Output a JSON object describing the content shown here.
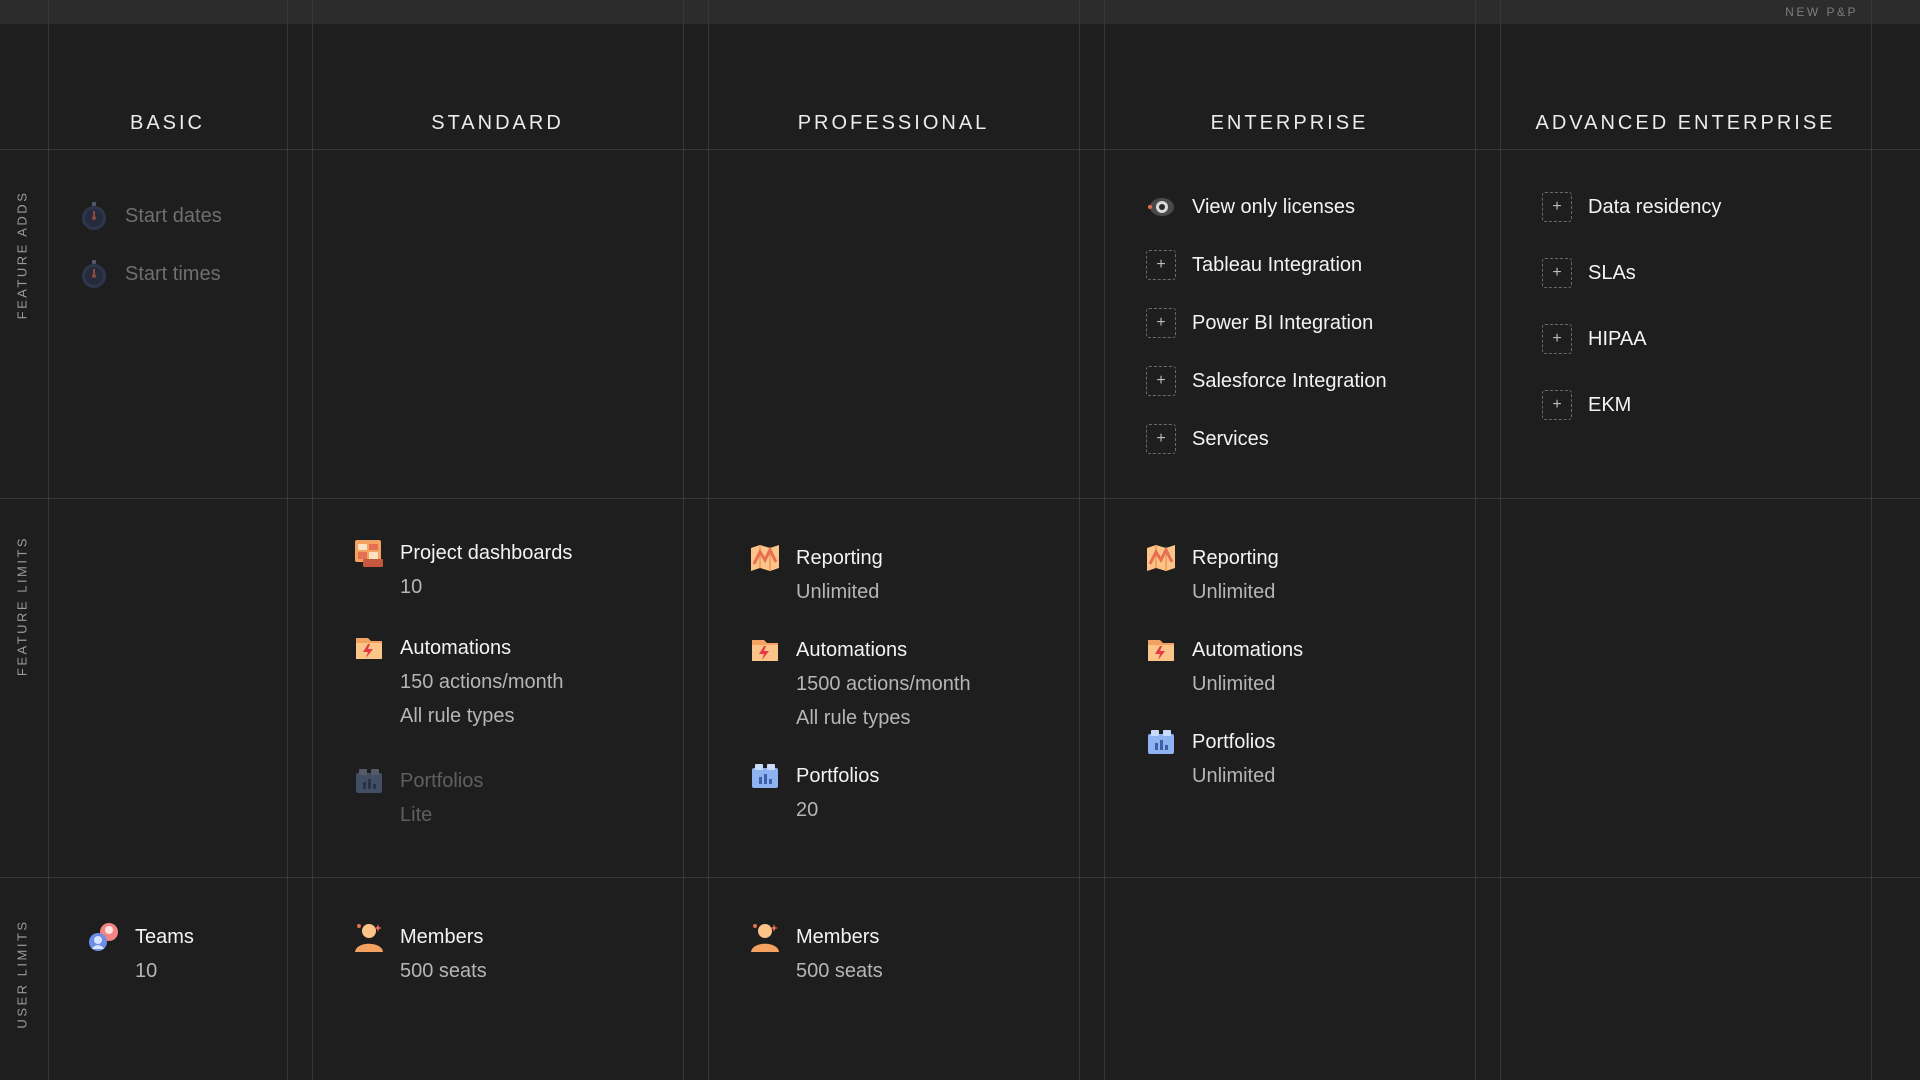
{
  "topbar": {
    "label": "NEW P&P"
  },
  "plans": [
    "BASIC",
    "STANDARD",
    "PROFESSIONAL",
    "ENTERPRISE",
    "ADVANCED ENTERPRISE"
  ],
  "row_labels": {
    "feature_adds": "FEATURE ADDS",
    "feature_limits": "FEATURE LIMITS",
    "user_limits": "USER LIMITS"
  },
  "feature_adds": {
    "basic": [
      {
        "icon": "stopwatch-icon",
        "title": "Start dates"
      },
      {
        "icon": "stopwatch-icon",
        "title": "Start times"
      }
    ],
    "enterprise": [
      {
        "icon": "eye-icon",
        "title": "View only licenses"
      },
      {
        "icon": "plus-icon",
        "title": "Tableau Integration"
      },
      {
        "icon": "plus-icon",
        "title": "Power BI Integration"
      },
      {
        "icon": "plus-icon",
        "title": "Salesforce Integration"
      },
      {
        "icon": "plus-icon",
        "title": "Services"
      }
    ],
    "advanced": [
      {
        "icon": "plus-icon",
        "title": "Data residency"
      },
      {
        "icon": "plus-icon",
        "title": "SLAs"
      },
      {
        "icon": "plus-icon",
        "title": "HIPAA"
      },
      {
        "icon": "plus-icon",
        "title": "EKM"
      }
    ]
  },
  "feature_limits": {
    "standard": [
      {
        "icon": "dashboard-icon",
        "title": "Project dashboards",
        "sub": [
          "10"
        ]
      },
      {
        "icon": "automation-icon",
        "title": "Automations",
        "sub": [
          "150 actions/month",
          "All rule types"
        ]
      },
      {
        "icon": "portfolio-icon",
        "title": "Portfolios",
        "sub": [
          "Lite"
        ]
      }
    ],
    "professional": [
      {
        "icon": "map-icon",
        "title": "Reporting",
        "sub": [
          "Unlimited"
        ]
      },
      {
        "icon": "automation-icon",
        "title": "Automations",
        "sub": [
          "1500 actions/month",
          "All rule types"
        ]
      },
      {
        "icon": "portfolio-icon",
        "title": "Portfolios",
        "sub": [
          "20"
        ]
      }
    ],
    "enterprise": [
      {
        "icon": "map-icon",
        "title": "Reporting",
        "sub": [
          "Unlimited"
        ]
      },
      {
        "icon": "automation-icon",
        "title": "Automations",
        "sub": [
          "Unlimited"
        ]
      },
      {
        "icon": "portfolio-icon",
        "title": "Portfolios",
        "sub": [
          "Unlimited"
        ]
      }
    ]
  },
  "user_limits": {
    "basic": [
      {
        "icon": "teams-icon",
        "title": "Teams",
        "sub": [
          "10"
        ]
      }
    ],
    "standard": [
      {
        "icon": "member-icon",
        "title": "Members",
        "sub": [
          "500 seats"
        ]
      }
    ],
    "professional": [
      {
        "icon": "member-icon",
        "title": "Members",
        "sub": [
          "500 seats"
        ]
      }
    ]
  },
  "colors": {
    "background": "#1e1e1e",
    "grid": "#373737",
    "accent_orange": "#f4a261",
    "accent_blue": "#8fb3f0"
  }
}
